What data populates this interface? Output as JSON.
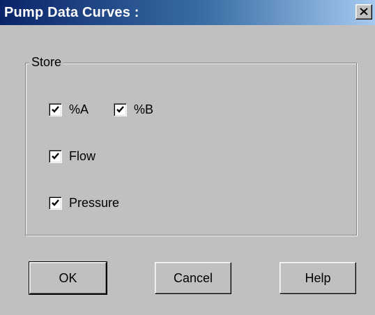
{
  "window": {
    "title": "Pump Data Curves :",
    "close_icon": "close-icon",
    "title_gradient": [
      "#0a246a",
      "#a6caf0"
    ]
  },
  "store_group": {
    "label": "Store",
    "checkboxes": [
      {
        "label": "%A",
        "checked": true
      },
      {
        "label": "%B",
        "checked": true
      },
      {
        "label": "Flow",
        "checked": true
      },
      {
        "label": "Pressure",
        "checked": true
      }
    ]
  },
  "buttons": {
    "ok": "OK",
    "cancel": "Cancel",
    "help": "Help"
  }
}
